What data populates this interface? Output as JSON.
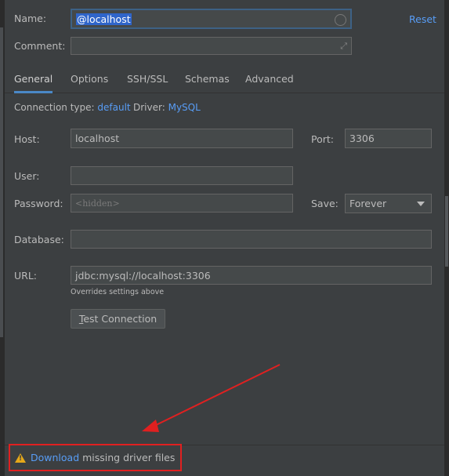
{
  "form": {
    "name_label": "Name:",
    "name_value": "@localhost",
    "reset_label": "Reset",
    "comment_label": "Comment:",
    "comment_value": ""
  },
  "tabs": [
    {
      "label": "General",
      "active": true
    },
    {
      "label": "Options",
      "active": false
    },
    {
      "label": "SSH/SSL",
      "active": false
    },
    {
      "label": "Schemas",
      "active": false
    },
    {
      "label": "Advanced",
      "active": false
    }
  ],
  "general": {
    "connection_type_label": "Connection type:",
    "connection_type_value": "default",
    "driver_label": "Driver:",
    "driver_value": "MySQL",
    "host_label": "Host:",
    "host_value": "localhost",
    "port_label": "Port:",
    "port_value": "3306",
    "user_label": "User:",
    "user_value": "",
    "password_label": "Password:",
    "password_placeholder": "<hidden>",
    "save_label": "Save:",
    "save_value": "Forever",
    "database_label": "Database:",
    "database_value": "",
    "url_label": "URL:",
    "url_value": "jdbc:mysql://localhost:3306",
    "url_hint": "Overrides settings above",
    "test_button": "Test Connection"
  },
  "footer": {
    "warning_link": "Download",
    "warning_text": " missing driver files"
  },
  "colors": {
    "background": "#3c3f41",
    "field_bg": "#45494a",
    "link": "#589df6",
    "selection": "#2f65ca",
    "annotation_red": "#e02020",
    "warning": "#e6a819"
  },
  "icons": [
    "clear-circle-icon",
    "expand-icon",
    "dropdown-arrow-icon",
    "warning-icon",
    "annotation-arrow"
  ]
}
